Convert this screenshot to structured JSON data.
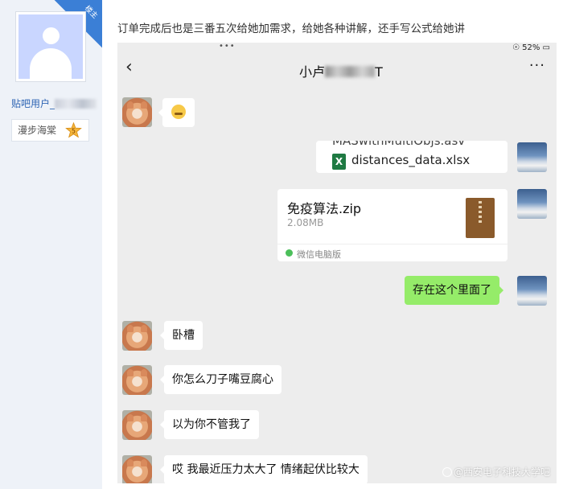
{
  "sidebar": {
    "corner_badge": "楼主",
    "username_prefix": "贴吧用户_",
    "badge_label": "漫步海棠",
    "badge_level": "5"
  },
  "post": {
    "text": "订单完成后也是三番五次给她加需求，给她各种讲解，还手写公式给她讲"
  },
  "phone": {
    "status": {
      "dots": "•••",
      "right": "☉ 52% ▭"
    },
    "header": {
      "back_icon": "‹",
      "title_prefix": "小卢",
      "title_suffix": "T",
      "more_icon": "···"
    },
    "messages": {
      "file1_cut": "MASwithMultiObjs.asv",
      "file1_name": "distances_data.xlsx",
      "file1_icon_letter": "X",
      "zip_name": "免疫算法.zip",
      "zip_size": "2.08MB",
      "zip_source": "微信电脑版",
      "reply_me": "存在这个里面了",
      "m1": "卧槽",
      "m2": "你怎么刀子嘴豆腐心",
      "m3": "以为你不管我了",
      "m4": "哎 我最近压力太大了 情绪起伏比较大"
    }
  },
  "watermark": "@西安电子科技大学吧",
  "colors": {
    "accent": "#3b7fd6",
    "bubble_me": "#95ec69",
    "chat_bg": "#ededed"
  }
}
